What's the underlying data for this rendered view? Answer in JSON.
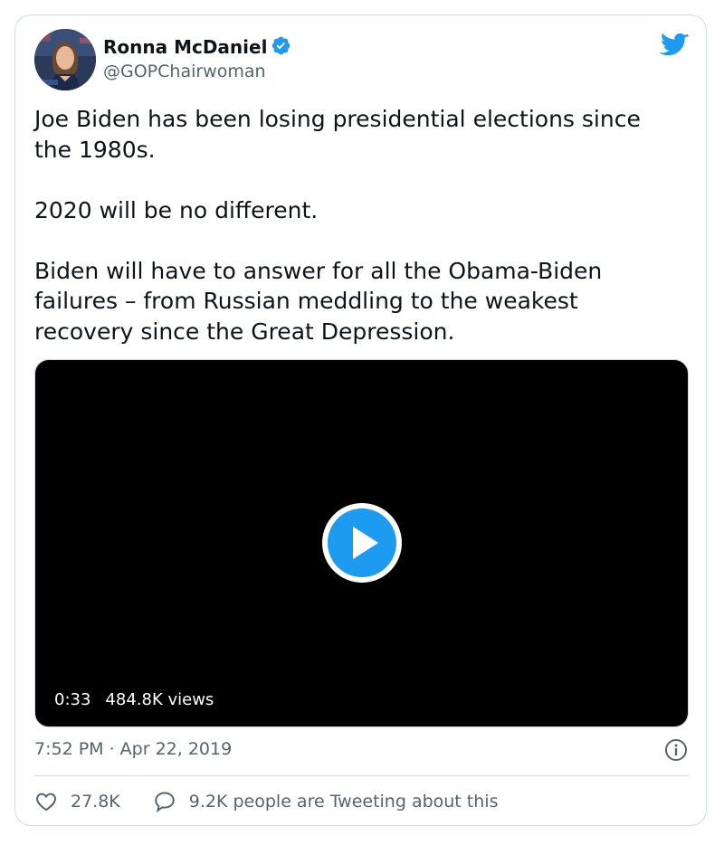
{
  "author": {
    "name": "Ronna McDaniel",
    "handle": "@GOPChairwoman"
  },
  "tweet": {
    "text": "Joe Biden has been losing presidential elections since\nthe 1980s.\n\n2020 will be no different.\n\nBiden will have to answer for all the Obama-Biden\nfailures – from Russian meddling to the weakest\nrecovery since the Great Depression."
  },
  "video": {
    "duration": "0:33",
    "views": "484.8K views"
  },
  "timestamp": "7:52 PM · Apr 22, 2019",
  "actions": {
    "likes": "27.8K",
    "conversation": "9.2K people are Tweeting about this"
  },
  "icons": {
    "twitter": "twitter-bird-icon",
    "verified": "verified-badge-icon",
    "play": "play-icon",
    "info": "info-icon",
    "like": "heart-icon",
    "reply": "speech-bubble-icon"
  },
  "colors": {
    "brand_blue": "#1d9bf0",
    "text": "#0f1419",
    "secondary": "#536471",
    "border": "#cfd9de"
  }
}
